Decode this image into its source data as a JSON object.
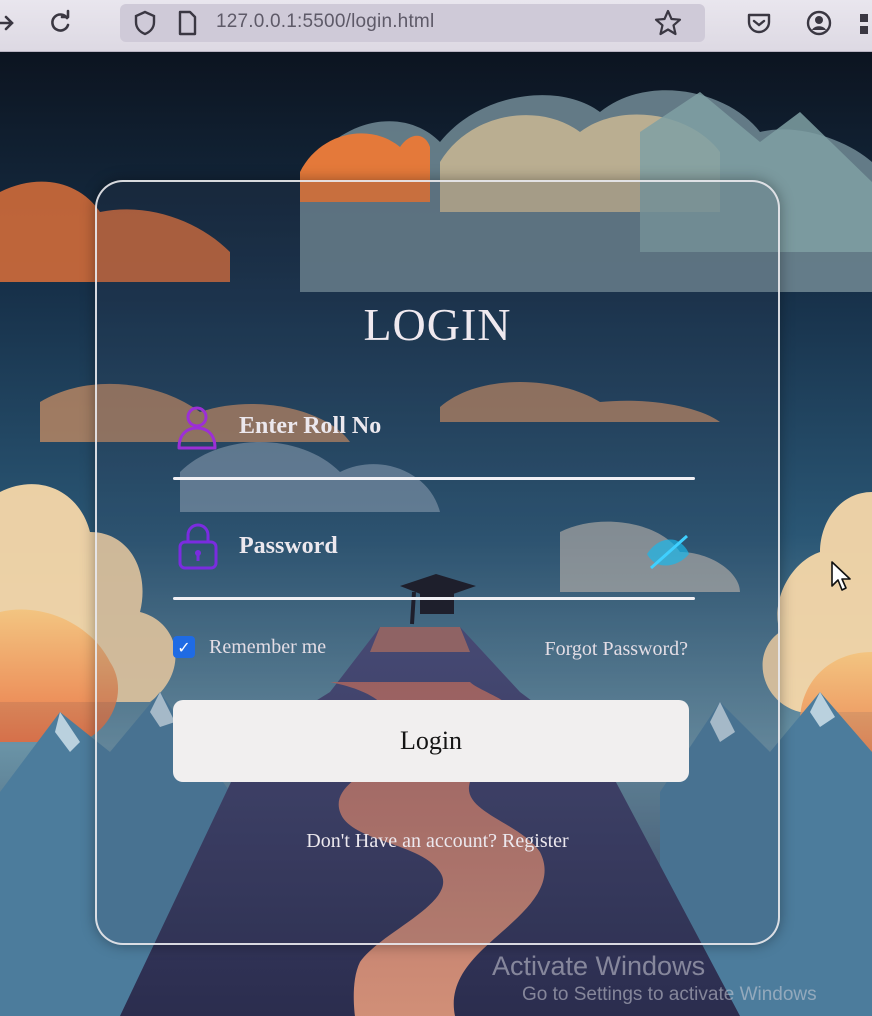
{
  "browser": {
    "url": "127.0.0.1:5500/login.html",
    "icons": [
      "back-arrow-icon",
      "reload-icon",
      "shield-icon",
      "page-icon",
      "star-icon",
      "pocket-icon",
      "account-icon"
    ]
  },
  "login_form": {
    "title": "LOGIN",
    "roll_placeholder": "Enter Roll No",
    "password_placeholder": "Password",
    "remember_label": "Remember me",
    "remember_checked": true,
    "forgot_label": "Forgot Password?",
    "submit_label": "Login",
    "register_prompt": "Don't Have an account?",
    "register_label": "Register"
  },
  "watermark": {
    "title": "Activate Windows",
    "subtitle": "Go to Settings to activate Windows"
  },
  "colors": {
    "card_border": "#e8e8ec",
    "checkbox": "#1f6be4",
    "user_icon": "#9c2fd6",
    "lock_icon": "#7a2ce0",
    "eye_icon": "#1bb6e8",
    "button_bg": "#f1efef"
  }
}
